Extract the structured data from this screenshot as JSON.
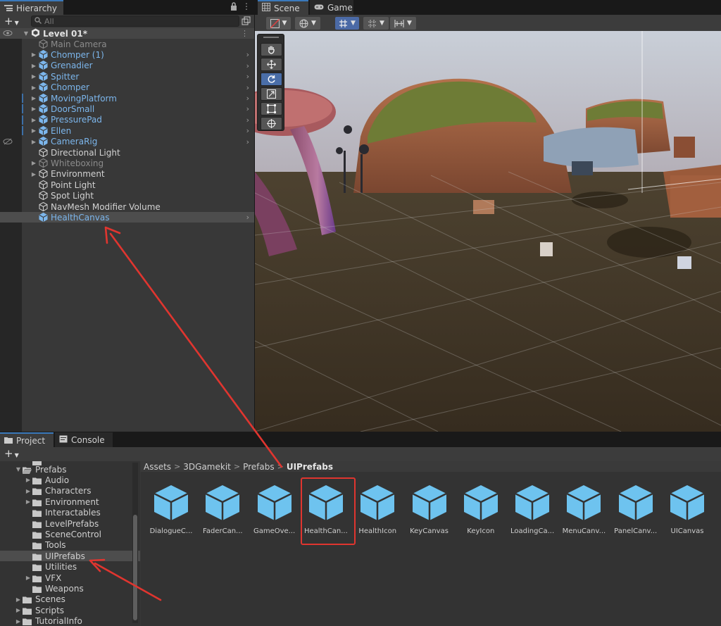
{
  "hierarchy": {
    "tab_label": "Hierarchy",
    "search_placeholder": "All",
    "scene_name": "Level 01*",
    "items": [
      {
        "label": "Main Camera",
        "style": "grey",
        "expandable": false,
        "chevron": false
      },
      {
        "label": "Chomper (1)",
        "style": "blue",
        "expandable": true,
        "chevron": true
      },
      {
        "label": "Grenadier",
        "style": "blue",
        "expandable": true,
        "chevron": true
      },
      {
        "label": "Spitter",
        "style": "blue",
        "expandable": true,
        "chevron": true
      },
      {
        "label": "Chomper",
        "style": "blue",
        "expandable": true,
        "chevron": true
      },
      {
        "label": "MovingPlatform",
        "style": "blue",
        "expandable": true,
        "chevron": true
      },
      {
        "label": "DoorSmall",
        "style": "blue",
        "expandable": true,
        "chevron": true
      },
      {
        "label": "PressurePad",
        "style": "blue",
        "expandable": true,
        "chevron": true
      },
      {
        "label": "Ellen",
        "style": "blue",
        "expandable": true,
        "chevron": true
      },
      {
        "label": "CameraRig",
        "style": "blue",
        "expandable": true,
        "chevron": true
      },
      {
        "label": "Directional Light",
        "style": "white",
        "expandable": false,
        "chevron": false
      },
      {
        "label": "Whiteboxing",
        "style": "grey",
        "expandable": true,
        "chevron": false
      },
      {
        "label": "Environment",
        "style": "white",
        "expandable": true,
        "chevron": false
      },
      {
        "label": "Point Light",
        "style": "white",
        "expandable": false,
        "chevron": false
      },
      {
        "label": "Spot Light",
        "style": "white",
        "expandable": false,
        "chevron": false
      },
      {
        "label": "NavMesh Modifier Volume",
        "style": "white",
        "expandable": false,
        "chevron": false
      },
      {
        "label": "HealthCanvas",
        "style": "blue",
        "expandable": false,
        "chevron": true,
        "selected": true
      }
    ]
  },
  "scene": {
    "tabs": [
      {
        "label": "Scene",
        "icon": "grid-icon"
      },
      {
        "label": "Game",
        "icon": "gamepad-icon"
      }
    ],
    "tools": [
      "hand-tool-icon",
      "move-tool-icon",
      "rotate-tool-icon",
      "scale-tool-icon",
      "rect-tool-icon",
      "transform-tool-icon"
    ],
    "active_tool": "rotate-tool-icon"
  },
  "project": {
    "tabs": [
      {
        "label": "Project",
        "icon": "folder-icon"
      },
      {
        "label": "Console",
        "icon": "console-icon"
      }
    ],
    "tree": [
      {
        "label": "Prefabs",
        "depth": 1,
        "expanded": true,
        "caret": "open"
      },
      {
        "label": "Audio",
        "depth": 2,
        "caret": "closed"
      },
      {
        "label": "Characters",
        "depth": 2,
        "caret": "closed"
      },
      {
        "label": "Environment",
        "depth": 2,
        "caret": "closed"
      },
      {
        "label": "Interactables",
        "depth": 2,
        "caret": "none"
      },
      {
        "label": "LevelPrefabs",
        "depth": 2,
        "caret": "none"
      },
      {
        "label": "SceneControl",
        "depth": 2,
        "caret": "none"
      },
      {
        "label": "Tools",
        "depth": 2,
        "caret": "none"
      },
      {
        "label": "UIPrefabs",
        "depth": 2,
        "caret": "none",
        "selected": true
      },
      {
        "label": "Utilities",
        "depth": 2,
        "caret": "none"
      },
      {
        "label": "VFX",
        "depth": 2,
        "caret": "closed"
      },
      {
        "label": "Weapons",
        "depth": 2,
        "caret": "none"
      },
      {
        "label": "Scenes",
        "depth": 1,
        "caret": "closed"
      },
      {
        "label": "Scripts",
        "depth": 1,
        "caret": "closed"
      },
      {
        "label": "TutorialInfo",
        "depth": 1,
        "caret": "closed"
      }
    ],
    "breadcrumb": [
      "Assets",
      "3DGamekit",
      "Prefabs",
      "UIPrefabs"
    ],
    "assets": [
      "DialogueC...",
      "FaderCan...",
      "GameOve...",
      "HealthCan...",
      "HealthIcon",
      "KeyCanvas",
      "KeyIcon",
      "LoadingCa...",
      "MenuCanv...",
      "PanelCanv...",
      "UICanvas"
    ],
    "highlighted_asset": "HealthCan..."
  },
  "colors": {
    "prefab_blue": "#7cb6ec",
    "annotation_red": "#e0352f",
    "selection_blue": "#3a79bb"
  }
}
